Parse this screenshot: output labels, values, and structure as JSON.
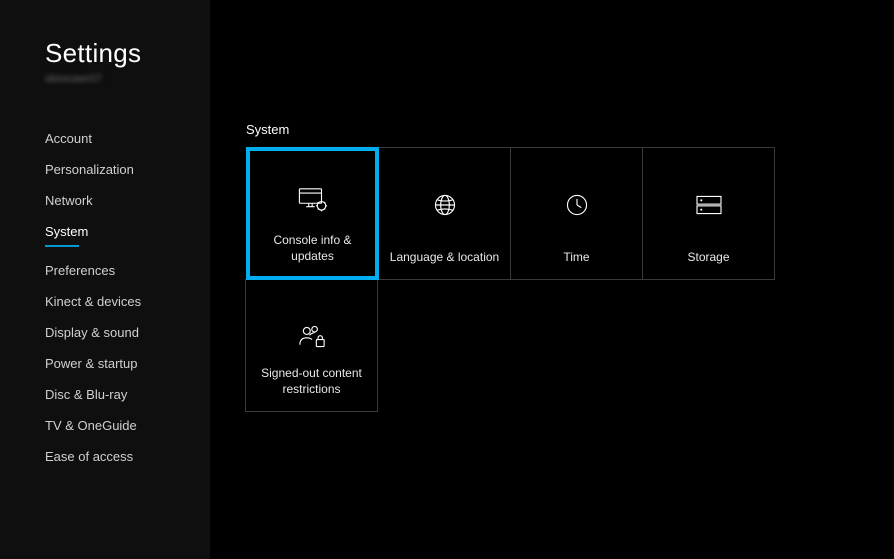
{
  "sidebar": {
    "title": "Settings",
    "profile": "xboxuser07",
    "items": [
      {
        "label": "Account",
        "active": false
      },
      {
        "label": "Personalization",
        "active": false
      },
      {
        "label": "Network",
        "active": false
      },
      {
        "label": "System",
        "active": true
      },
      {
        "label": "Preferences",
        "active": false
      },
      {
        "label": "Kinect & devices",
        "active": false
      },
      {
        "label": "Display & sound",
        "active": false
      },
      {
        "label": "Power & startup",
        "active": false
      },
      {
        "label": "Disc & Blu-ray",
        "active": false
      },
      {
        "label": "TV & OneGuide",
        "active": false
      },
      {
        "label": "Ease of access",
        "active": false
      }
    ]
  },
  "main": {
    "section_header": "System",
    "tiles": [
      {
        "label": "Console info & updates",
        "icon": "console-gear-icon",
        "selected": true
      },
      {
        "label": "Language & location",
        "icon": "globe-icon",
        "selected": false
      },
      {
        "label": "Time",
        "icon": "clock-icon",
        "selected": false
      },
      {
        "label": "Storage",
        "icon": "storage-icon",
        "selected": false
      },
      {
        "label": "Signed-out content restrictions",
        "icon": "people-lock-icon",
        "selected": false
      }
    ]
  }
}
